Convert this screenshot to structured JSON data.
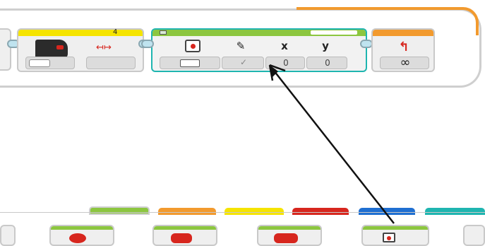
{
  "program": {
    "port_value": "4",
    "display_block": {
      "params": [
        "x",
        "y"
      ],
      "x_default": "0",
      "y_default": "0"
    },
    "loop_symbol": "∞"
  },
  "palette": {
    "tab_colors": [
      "#8cc63f",
      "#f29a2e",
      "#f5e400",
      "#d7261e",
      "#1f6fd1",
      "#1fb5b0"
    ],
    "active_tab": 0
  },
  "annotation": {
    "color": "#111111"
  }
}
